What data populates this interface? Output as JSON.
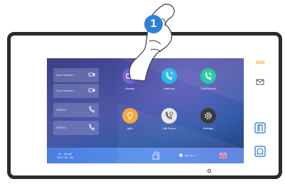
{
  "device": {
    "sos_label": "SOS",
    "side_icons": [
      "message-icon",
      "door-icon",
      "alarm-icon"
    ]
  },
  "callout": {
    "step_number": "1"
  },
  "sidebar": {
    "items": [
      {
        "label": "Door Station 1",
        "icon": "camera-icon"
      },
      {
        "label": "Door Station 2",
        "icon": "camera-icon"
      },
      {
        "label": "HISEC1",
        "icon": "phone-icon"
      },
      {
        "label": "HISEC1",
        "icon": "phone-icon"
      }
    ]
  },
  "apps": [
    {
      "label": "Monitor",
      "color": "#7a5fd8",
      "icon": "monitor-icon"
    },
    {
      "label": "Intercom",
      "color": "#28b8ea",
      "icon": "intercom-icon"
    },
    {
      "label": "Call Record",
      "color": "#1fc79a",
      "icon": "call-record-icon"
    },
    {
      "label": "light",
      "color": "#f3a532",
      "icon": "light-icon"
    },
    {
      "label": "Call Scene",
      "color": "#e8e8ec",
      "icon": "call-scene-icon"
    },
    {
      "label": "Settings",
      "color": "#3a3a3a",
      "icon": "gear-icon"
    }
  ],
  "statusbar": {
    "time": "12 : 06 AM",
    "date": "2017-09 - 20",
    "indoor_label": "HIS_Fam 1",
    "icons": [
      "unlock-icon",
      "indoor-icon",
      "message-icon"
    ]
  }
}
